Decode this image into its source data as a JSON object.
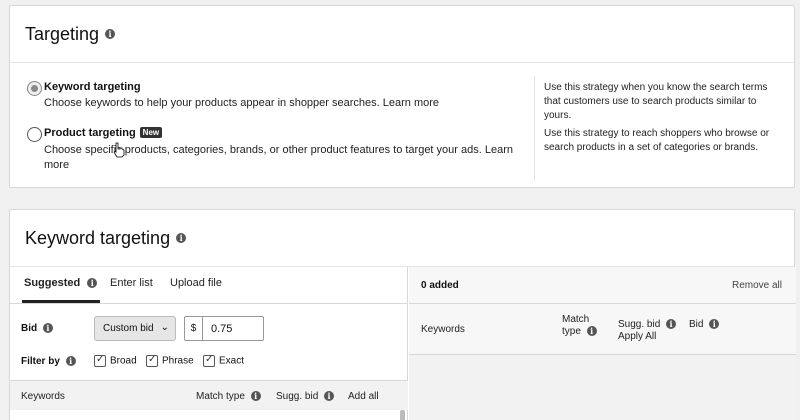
{
  "targeting": {
    "title": "Targeting",
    "options": [
      {
        "label": "Keyword targeting",
        "selected": true,
        "desc_line1": "Choose keywords to help your products appear in shopper searches.",
        "link": "Learn more",
        "note_line1": "Use this strategy when you know the search terms",
        "note_line2": "that customers use to search products similar to",
        "note_line3": "yours."
      },
      {
        "label": "Product targeting",
        "badge": "New",
        "selected": false,
        "desc_line1": "Choose specific products, categories, brands, or other product features to target your ads.",
        "link": "Learn",
        "desc_line2": "more",
        "note_line1": "Use this strategy to reach shoppers who browse or",
        "note_line2": "search products in a set of categories or brands."
      }
    ]
  },
  "keyword_targeting": {
    "title": "Keyword targeting",
    "tabs": [
      "Suggested",
      "Enter list",
      "Upload file"
    ],
    "bid_label": "Bid",
    "bid_select": "Custom bid",
    "currency": "$",
    "bid_value": "0.75",
    "filter_label": "Filter by",
    "filters": [
      "Broad",
      "Phrase",
      "Exact"
    ],
    "table_headers": {
      "keywords": "Keywords",
      "match_type": "Match type",
      "sugg_bid": "Sugg. bid",
      "add_all": "Add all"
    },
    "added": {
      "count_label": "0 added",
      "remove_all": "Remove all",
      "col_keywords": "Keywords",
      "col_match_line1": "Match",
      "col_match_line2": "type",
      "col_sugg_bid": "Sugg. bid",
      "col_apply_all": "Apply All",
      "col_bid": "Bid"
    }
  }
}
